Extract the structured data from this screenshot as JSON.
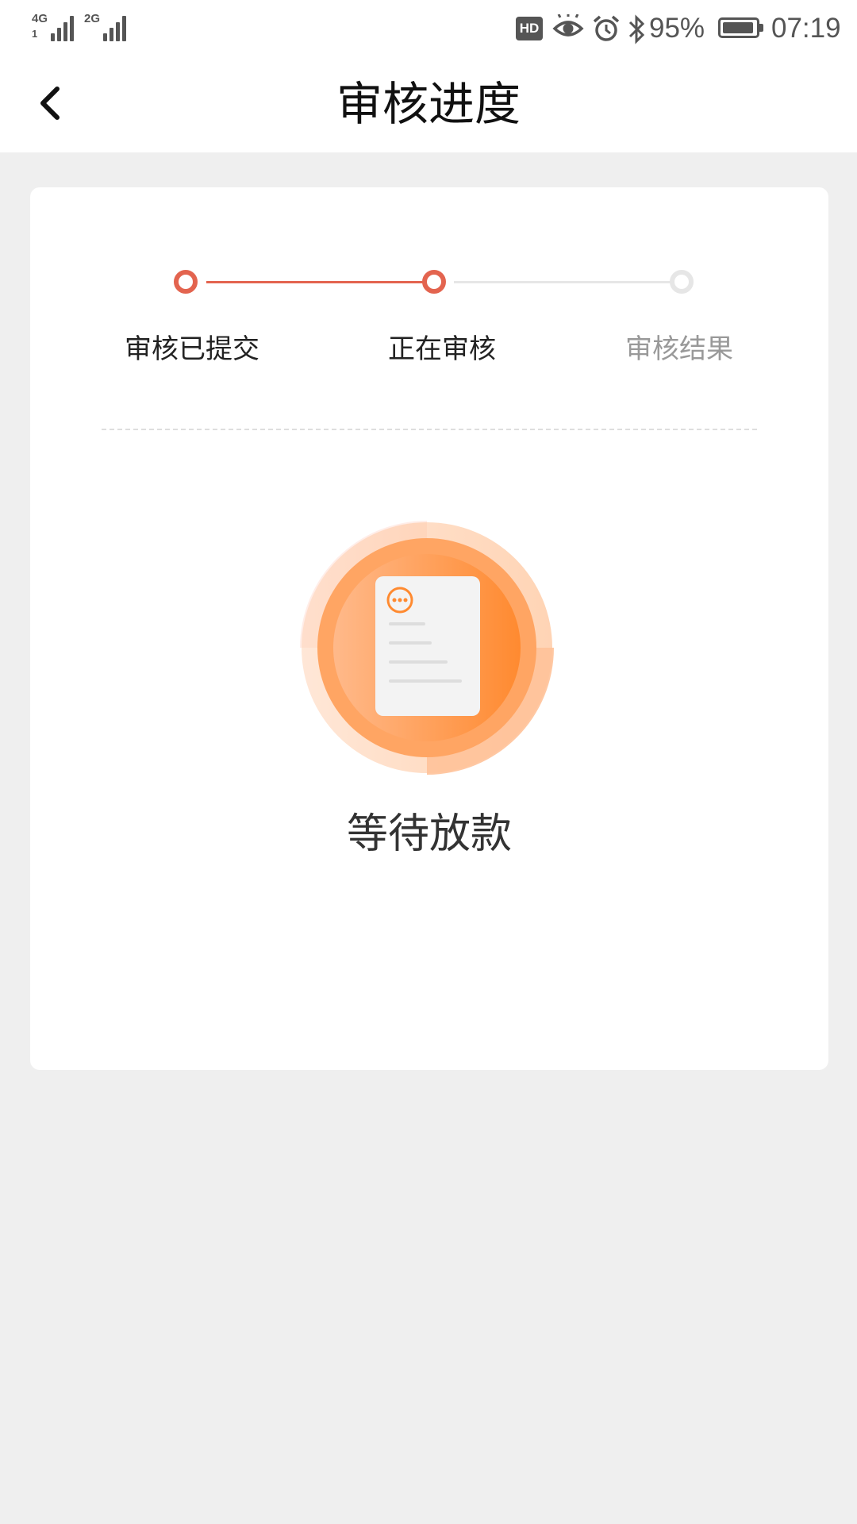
{
  "status_bar": {
    "network1": {
      "label": "4G",
      "sub": "1"
    },
    "network2": {
      "label": "2G"
    },
    "hd": "HD",
    "battery_percent": "95%",
    "battery_level": 0.95,
    "time": "07:19",
    "icons": [
      "eye-icon",
      "alarm-icon",
      "bluetooth-icon"
    ]
  },
  "header": {
    "title": "审核进度",
    "back_icon": "chevron-left-icon"
  },
  "steps": [
    {
      "label": "审核已提交",
      "state": "done"
    },
    {
      "label": "正在审核",
      "state": "current"
    },
    {
      "label": "审核结果",
      "state": "pending"
    }
  ],
  "status": {
    "text": "等待放款",
    "icon": "document-pending-icon"
  },
  "colors": {
    "accent": "#e3644f",
    "inactive": "#e6e6e6",
    "inactive_text": "#999999",
    "orange": "#ff8a30",
    "page_bg": "#efefef"
  }
}
